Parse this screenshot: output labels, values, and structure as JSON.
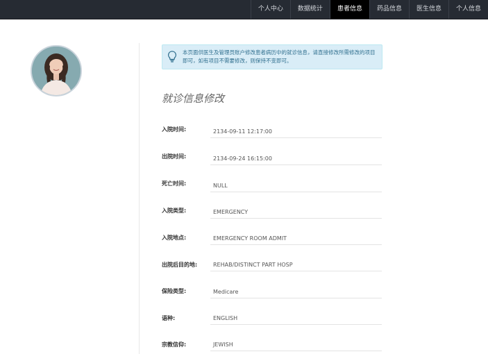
{
  "nav": {
    "items": [
      {
        "label": "个人中心",
        "active": false
      },
      {
        "label": "数据统计",
        "active": false
      },
      {
        "label": "患者信息",
        "active": true
      },
      {
        "label": "药品信息",
        "active": false
      },
      {
        "label": "医生信息",
        "active": false
      },
      {
        "label": "个人信息",
        "active": false
      }
    ]
  },
  "profile": {
    "avatar_icon": "user-avatar-photo"
  },
  "alert": {
    "icon": "lightbulb-icon",
    "text": "本页面供医生及管理员账户修改患者病历中的就诊信息，请直接修改所需修改的项目即可，如有项目不需要修改，则保持不变即可。"
  },
  "form": {
    "title": "就诊信息修改",
    "fields": [
      {
        "label": "入院时间:",
        "value": "2134-09-11 12:17:00"
      },
      {
        "label": "出院时间:",
        "value": "2134-09-24 16:15:00"
      },
      {
        "label": "死亡时间:",
        "value": "NULL"
      },
      {
        "label": "入院类型:",
        "value": "EMERGENCY"
      },
      {
        "label": "入院地点:",
        "value": "EMERGENCY ROOM ADMIT"
      },
      {
        "label": "出院后目的地:",
        "value": "REHAB/DISTINCT PART HOSP"
      },
      {
        "label": "保险类型:",
        "value": "Medicare"
      },
      {
        "label": "语种:",
        "value": "ENGLISH"
      },
      {
        "label": "宗教信仰:",
        "value": "JEWISH"
      }
    ]
  }
}
